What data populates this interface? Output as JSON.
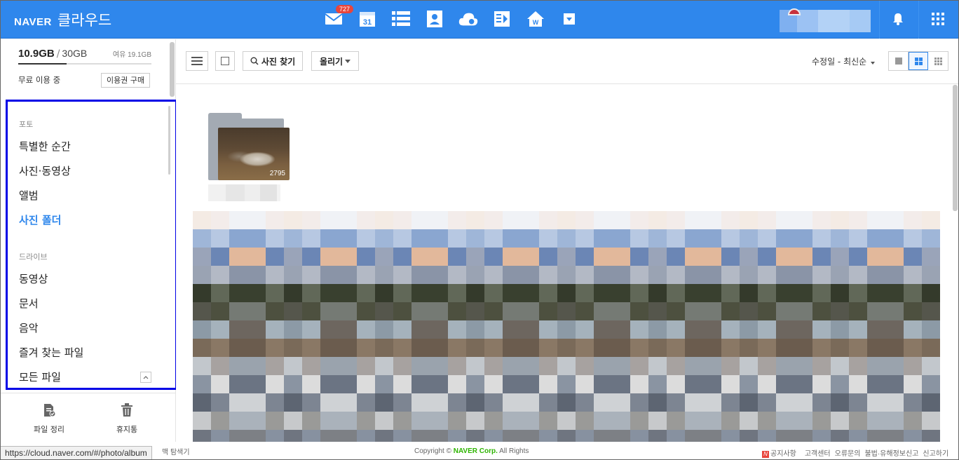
{
  "header": {
    "brand_naver": "NAVER",
    "brand_cloud": "클라우드",
    "mail_badge": "727",
    "calendar_day": "31",
    "brand_color": "#2f87ec",
    "icons": [
      "mail-icon",
      "calendar-icon",
      "list-icon",
      "contacts-icon",
      "cloud-icon",
      "memo-icon",
      "home-icon",
      "more-icon",
      "bell-icon",
      "apps-grid-icon"
    ]
  },
  "sidebar": {
    "storage_used": "10.9GB",
    "storage_separator": "/",
    "storage_total": "30GB",
    "storage_free": "여유 19.1GB",
    "storage_fraction": 0.363,
    "plan_status": "무료 이용 중",
    "buy_button": "이용권 구매",
    "photo_section": "포토",
    "photo_items": [
      "특별한 순간",
      "사진·동영상",
      "앨범",
      "사진 폴더"
    ],
    "active_item": "사진 폴더",
    "drive_section": "드라이브",
    "drive_items": [
      "동영상",
      "문서",
      "음악",
      "즐겨 찾는 파일",
      "모든 파일"
    ],
    "tools": {
      "organize": "파일 정리",
      "trash": "휴지통"
    }
  },
  "toolbar": {
    "photo_search": "사진 찾기",
    "upload": "올리기",
    "sort": "수정일 - 최신순"
  },
  "content": {
    "folder_count": "2795"
  },
  "footer": {
    "copyright_prefix": "Copyright ©",
    "copyright_company": "NAVER Corp.",
    "copyright_suffix": "All Rights",
    "tip": "맥 탐색기",
    "links": [
      "공지사항",
      "고객센터",
      "오류문의",
      "불법·유해정보신고",
      "신고하기"
    ]
  },
  "status_url": "https://cloud.naver.com/#/photo/album"
}
